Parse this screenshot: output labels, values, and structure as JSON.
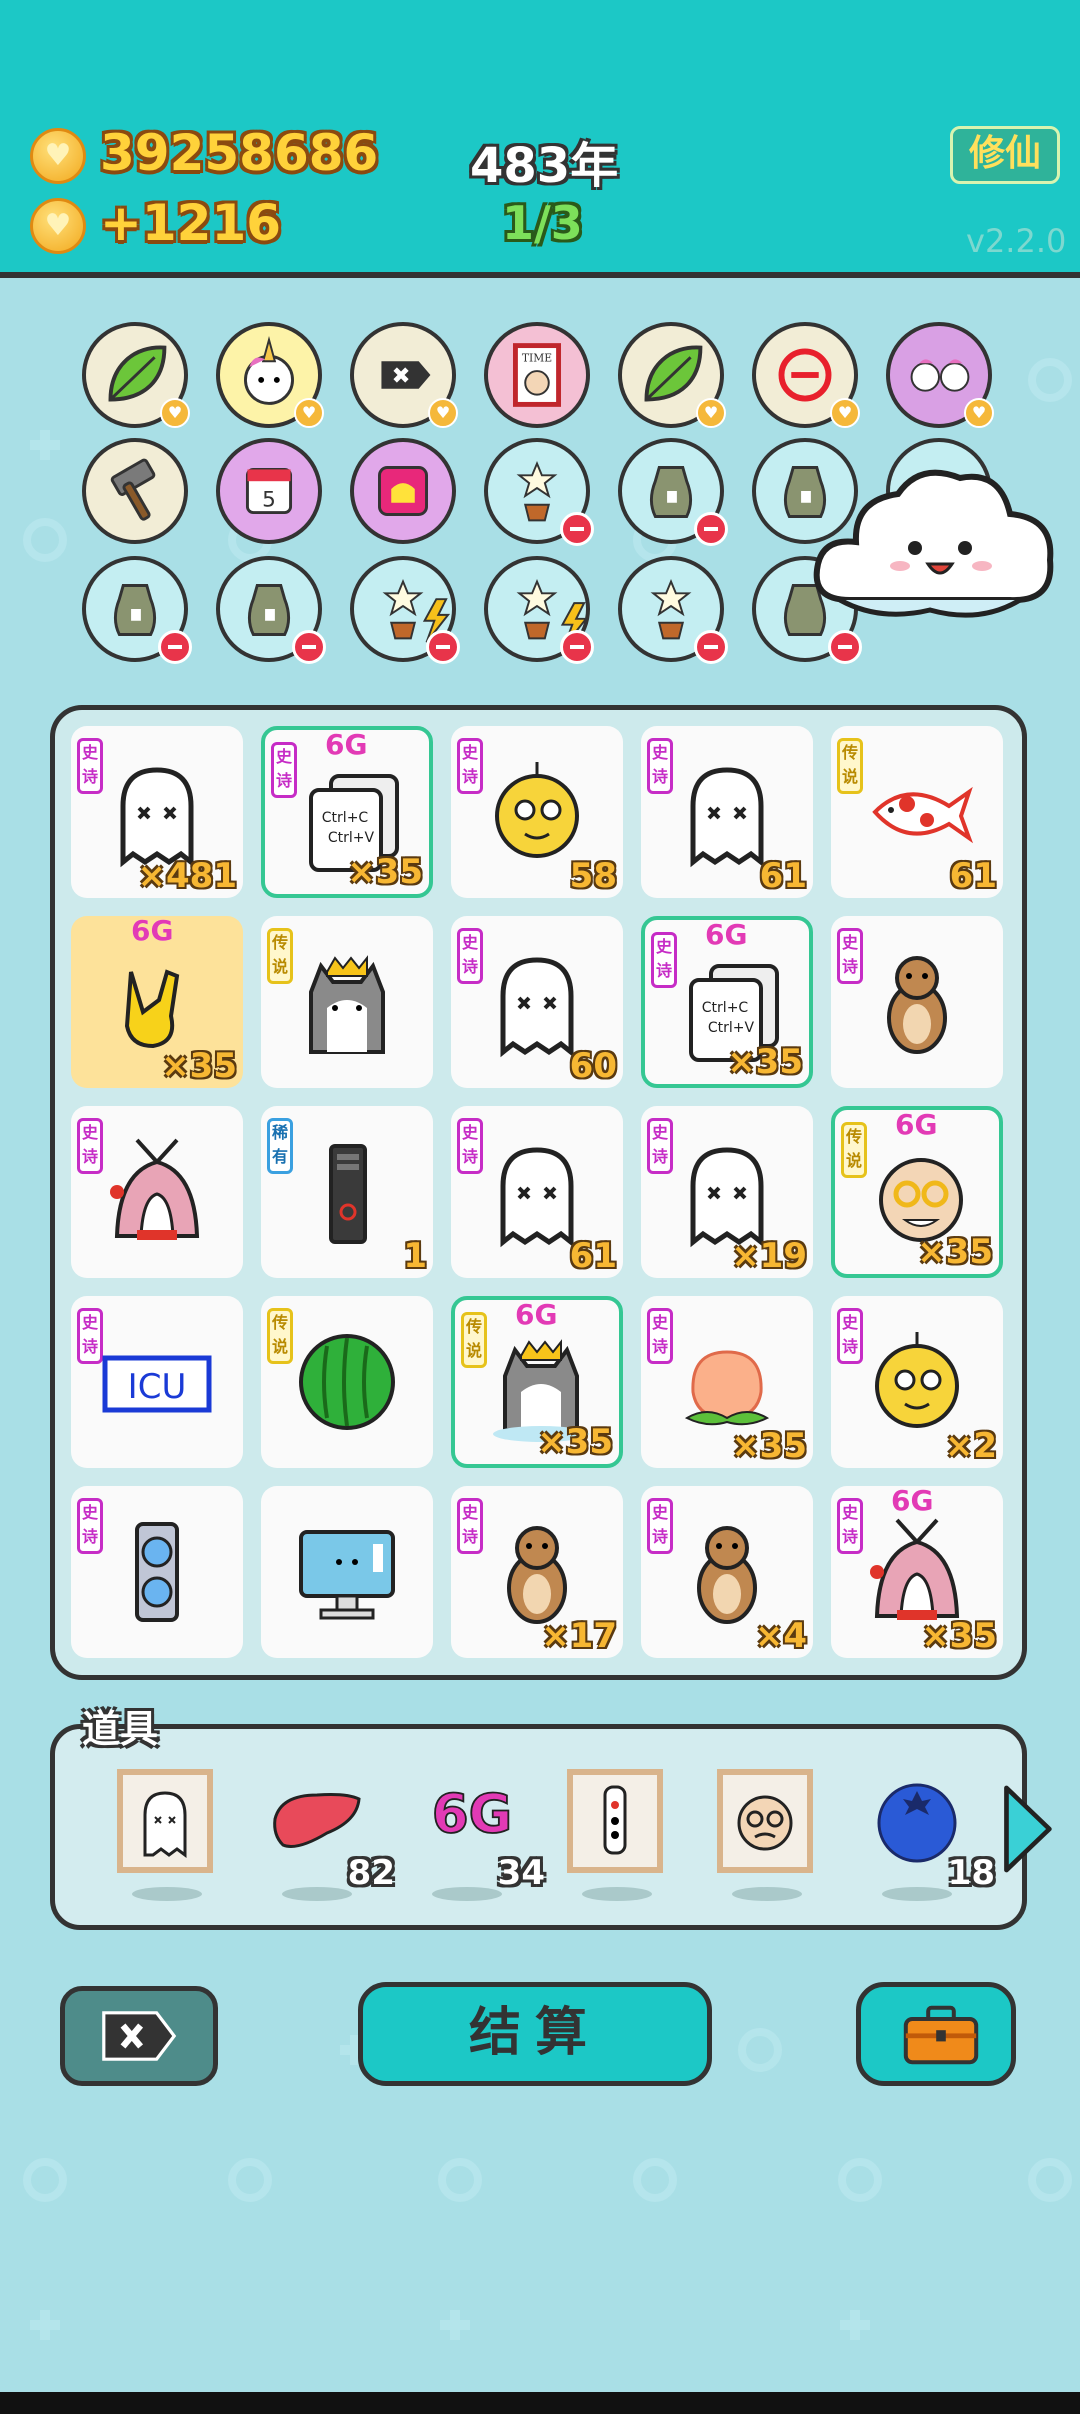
{
  "header": {
    "coins": "39258686",
    "income": "+1216",
    "year": "483年",
    "progress": "1/3",
    "cultivate_button": "修仙",
    "version": "v2.2.0"
  },
  "board": {
    "tiles": [
      {
        "tag": "史诗",
        "count": "×481"
      },
      {
        "tag": "史诗",
        "count": "×35",
        "sixg": "6G"
      },
      {
        "tag": "史诗",
        "count": "58"
      },
      {
        "tag": "史诗",
        "count": "61"
      },
      {
        "tag": "传说",
        "count": "61"
      },
      {
        "tag": "",
        "count": "×35",
        "sixg": "6G"
      },
      {
        "tag": "传说",
        "count": ""
      },
      {
        "tag": "史诗",
        "count": "60"
      },
      {
        "tag": "史诗",
        "count": "×35",
        "sixg": "6G"
      },
      {
        "tag": "史诗",
        "count": ""
      },
      {
        "tag": "史诗",
        "count": ""
      },
      {
        "tag": "稀有",
        "count": "1"
      },
      {
        "tag": "史诗",
        "count": "61"
      },
      {
        "tag": "史诗",
        "count": "×19"
      },
      {
        "tag": "传说",
        "count": "×35",
        "sixg": "6G"
      },
      {
        "tag": "史诗",
        "count": ""
      },
      {
        "tag": "传说",
        "count": ""
      },
      {
        "tag": "传说",
        "count": "×35",
        "sixg": "6G"
      },
      {
        "tag": "史诗",
        "count": "×35"
      },
      {
        "tag": "史诗",
        "count": "×2"
      },
      {
        "tag": "史诗",
        "count": ""
      },
      {
        "tag": "",
        "count": ""
      },
      {
        "tag": "史诗",
        "count": "×17"
      },
      {
        "tag": "史诗",
        "count": "×4"
      },
      {
        "tag": "史诗",
        "count": "×35",
        "sixg": "6G"
      }
    ],
    "icu_text": "ICU",
    "copy_text_1": "Ctrl+C",
    "copy_text_2": "Ctrl+V",
    "sixg_label": "6G",
    "time_label": "TIME",
    "calendar_day": "5"
  },
  "props": {
    "title": "道具",
    "liver_count": "82",
    "sixg_count": "34",
    "blueberry_count": "18"
  },
  "actions": {
    "settle_label": "结算"
  }
}
